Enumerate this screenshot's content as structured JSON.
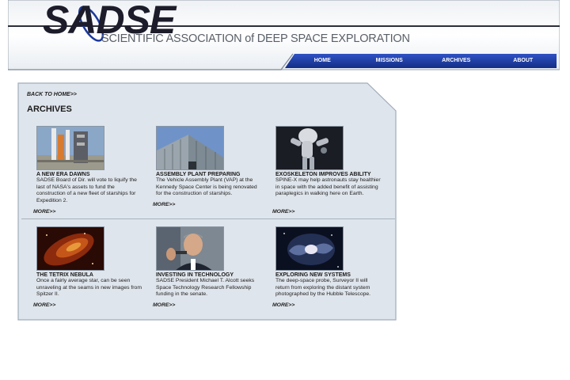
{
  "header": {
    "logo": "SADSE",
    "tagline": "SCIENTIFIC ASSOCIATION of DEEP SPACE EXPLORATION",
    "nav": [
      "HOME",
      "MISSIONS",
      "ARCHIVES",
      "ABOUT"
    ]
  },
  "content": {
    "back_link": "BACK TO HOME>>",
    "section_title": "ARCHIVES",
    "cards": [
      {
        "title": "A NEW ERA DAWNS",
        "desc": "SADSE Board of Dir. will vote to liquify the last of NASA's assets to fund the construction of a new fleet of starships for Expedition 2.",
        "more": "MORE>>",
        "image": "shuttle-launchpad"
      },
      {
        "title": "ASSEMBLY PLANT PREPARING",
        "desc": "The Vehicle Assembly Plant (VAP) at the Kennedy Space Center is being renovated for the construction of starships.",
        "more": "MORE>>",
        "image": "assembly-building"
      },
      {
        "title": "EXOSKELETON IMPROVES ABILITY",
        "desc": "SPINE-X may help astronauts stay healthier in space with the added benefit of assisting paraplegics in walking here on Earth.",
        "more": "MORE>>",
        "image": "robotic-exoskeleton"
      },
      {
        "title": "THE TETRIX NEBULA",
        "desc": "Once a fairly average star, can be seen unraveling at the seams in new images from Spitzer II.",
        "more": "MORE>>",
        "image": "nebula"
      },
      {
        "title": "INVESTING IN TECHNOLOGY",
        "desc": "SADSE President Michael T. Alcott seeks Space Technology Research Fellowship funding in the senate.",
        "more": "MORE>>",
        "image": "speaker-portrait"
      },
      {
        "title": "EXPLORING NEW SYSTEMS",
        "desc": "The deep-space probe, Surveyor II will return from exploring the distant system photographed by the Hubble Telescope.",
        "more": "MORE>>",
        "image": "spiral-galaxy"
      }
    ]
  },
  "colors": {
    "nav_blue": "#1e3c9c",
    "panel_fill": "#dfe5ec",
    "panel_border": "#a0adba"
  }
}
